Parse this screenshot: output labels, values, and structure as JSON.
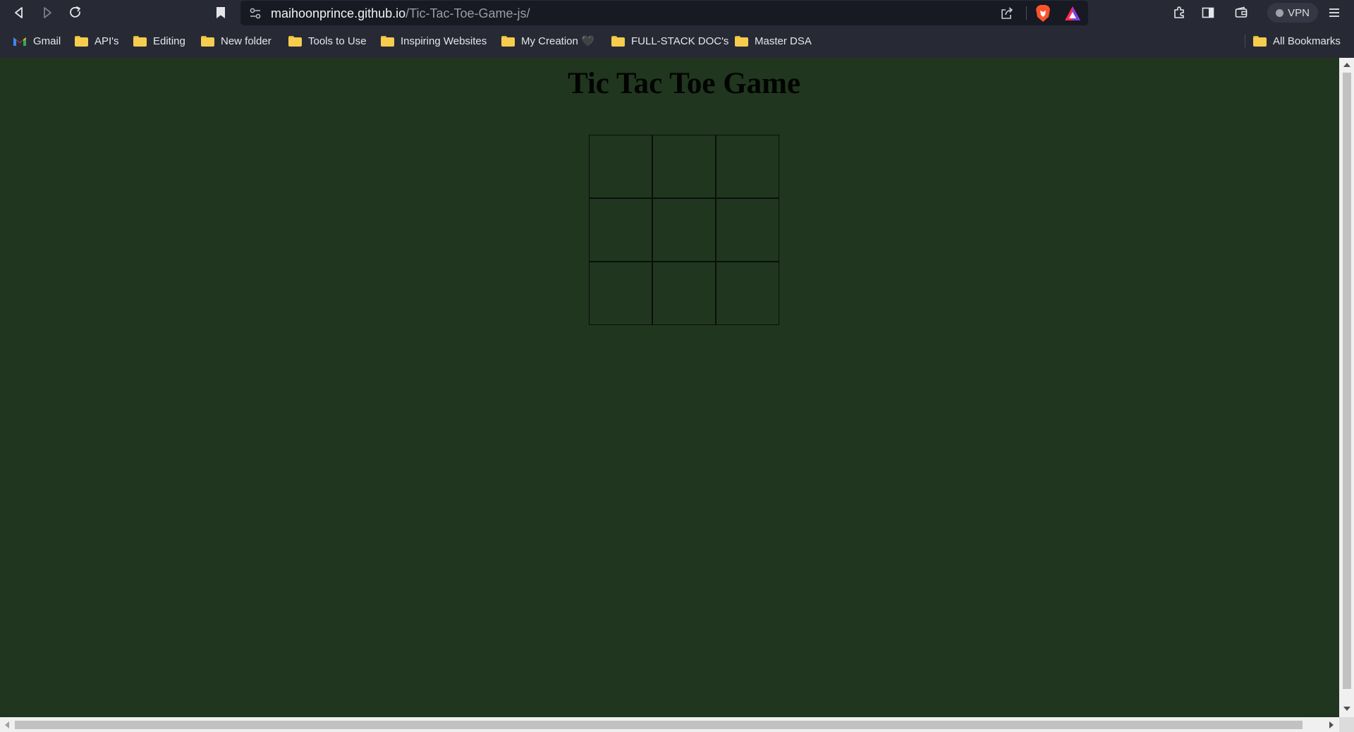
{
  "browser": {
    "url_host": "maihoonprince.github.io",
    "url_path": "/Tic-Tac-Toe-Game-js/",
    "vpn_label": "VPN",
    "icons": {
      "back": "back-icon",
      "forward": "forward-icon",
      "reload": "reload-icon",
      "bookmark": "bookmark-icon",
      "site_settings": "site-settings-icon",
      "share": "share-icon",
      "brave_shields": "brave-lion-icon",
      "brave_rewards": "brave-rewards-icon",
      "extensions": "extensions-icon",
      "sidebar": "sidebar-icon",
      "wallet": "wallet-icon",
      "menu": "menu-icon"
    }
  },
  "bookmarks": {
    "items": [
      {
        "label": "Gmail",
        "icon": "gmail-icon"
      },
      {
        "label": "API's",
        "icon": "folder-icon"
      },
      {
        "label": "Editing",
        "icon": "folder-icon"
      },
      {
        "label": "New folder",
        "icon": "folder-icon"
      },
      {
        "label": "Tools to Use",
        "icon": "folder-icon"
      },
      {
        "label": "Inspiring Websites",
        "icon": "folder-icon"
      },
      {
        "label": "My Creation 🖤",
        "icon": "folder-icon"
      },
      {
        "label": "FULL-STACK DOC's",
        "icon": "folder-icon"
      },
      {
        "label": "Master DSA",
        "icon": "folder-icon"
      }
    ],
    "all_bookmarks": "All Bookmarks"
  },
  "page": {
    "title": "Tic Tac Toe Game",
    "background": "#21361f",
    "board": {
      "cells": [
        "",
        "",
        "",
        "",
        "",
        "",
        "",
        "",
        ""
      ]
    }
  }
}
